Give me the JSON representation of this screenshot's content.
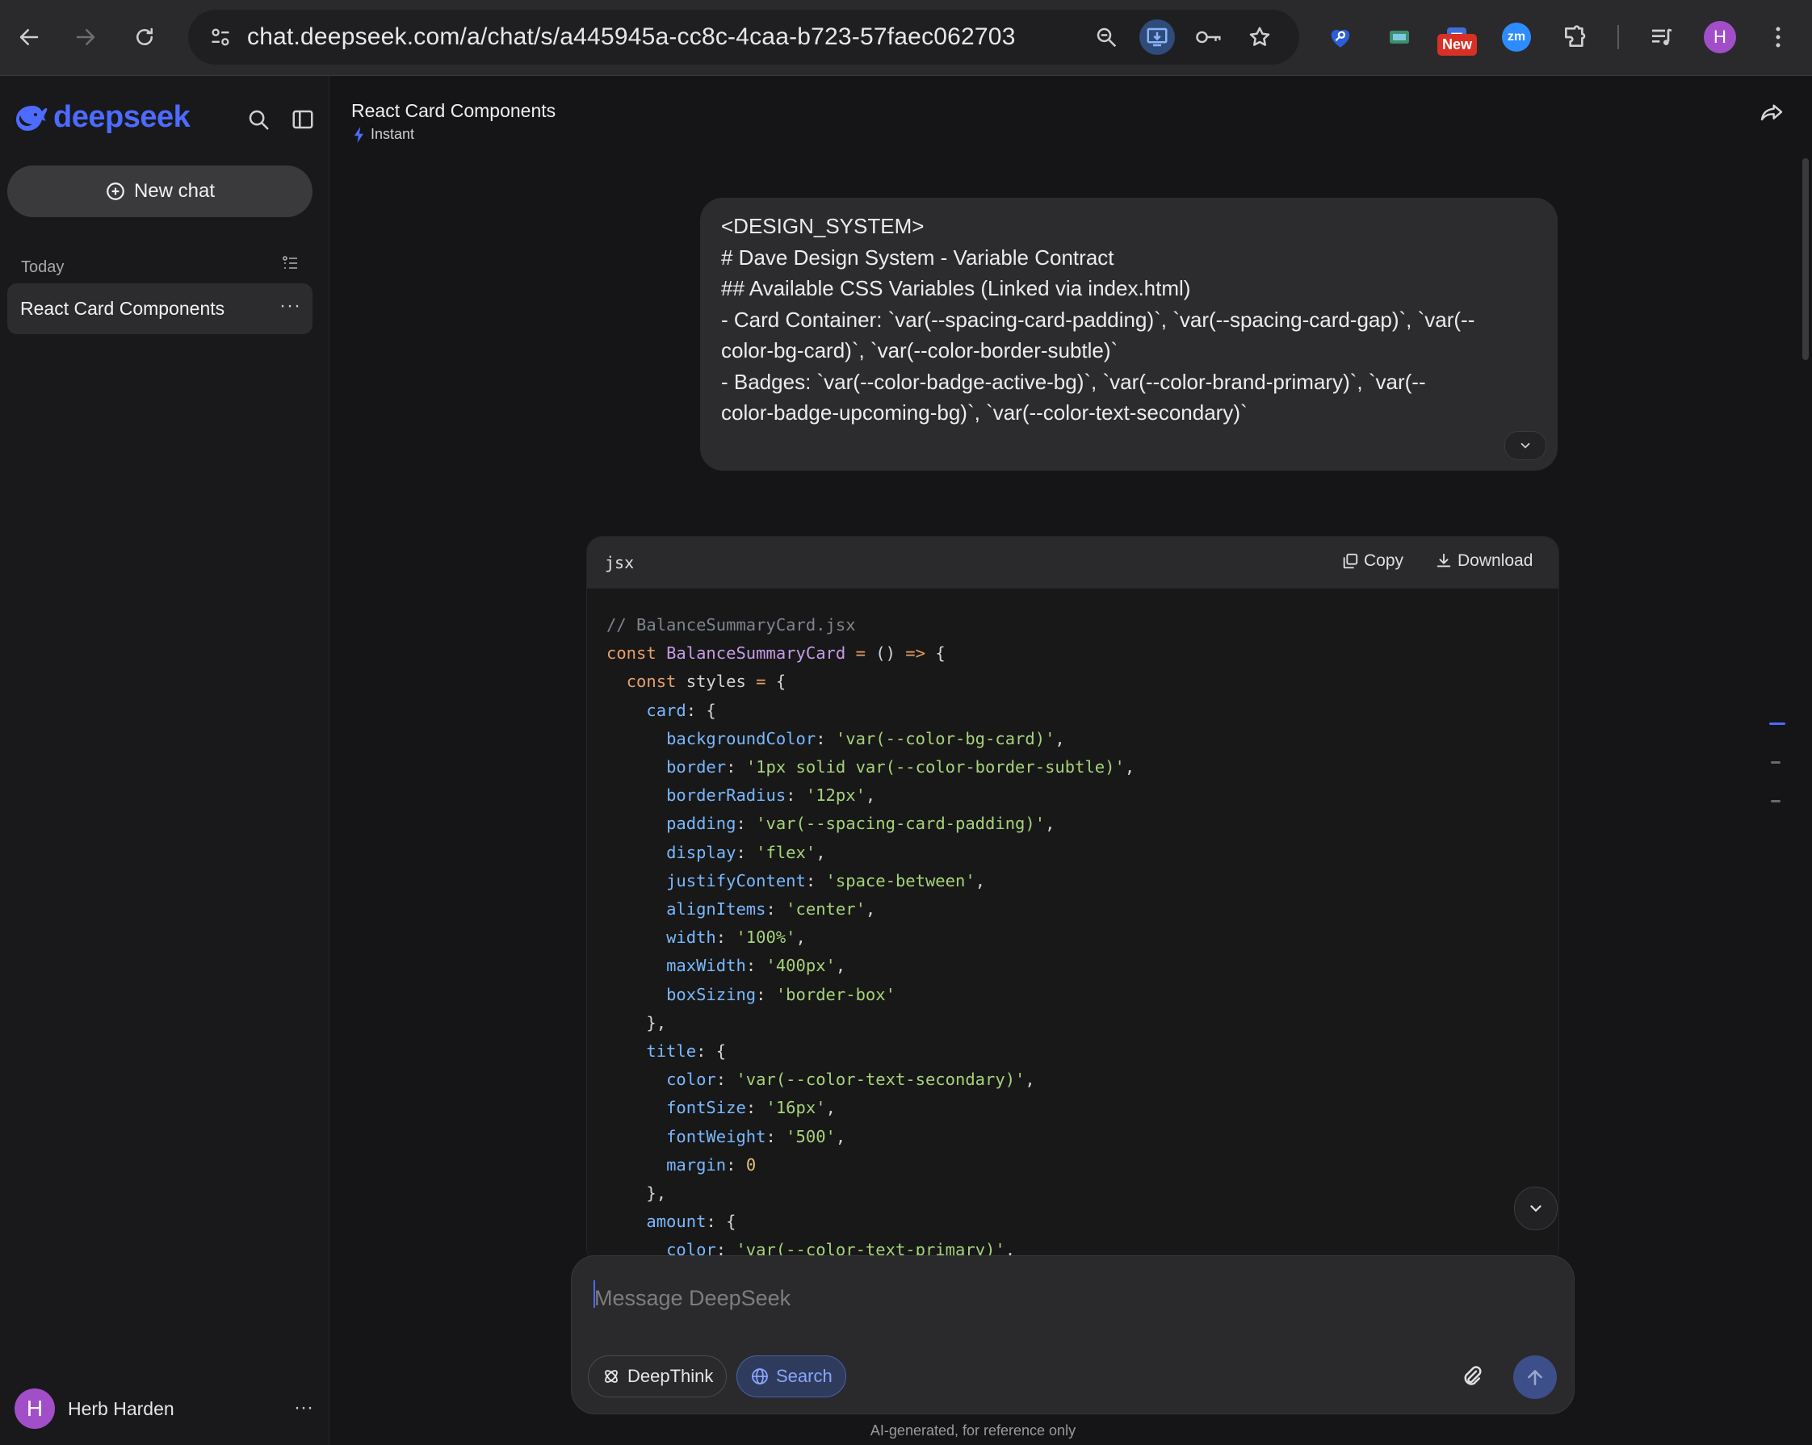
{
  "browser": {
    "url": "chat.deepseek.com/a/chat/s/a445945a-cc8c-4caa-b723-57faec062703",
    "new_badge": "New",
    "zoom_ext_label": "zm",
    "profile_initial": "H"
  },
  "sidebar": {
    "logo_text": "deepseek",
    "new_chat_label": "New chat",
    "section_today": "Today",
    "chats": [
      {
        "label": "React Card Components",
        "more": "···"
      }
    ],
    "user": {
      "initial": "H",
      "name": "Herb Harden",
      "more": "···"
    }
  },
  "chat": {
    "title": "React Card Components",
    "mode": "Instant",
    "user_message_lines": [
      "<DESIGN_SYSTEM>",
      "# Dave Design System - Variable Contract",
      "",
      "## Available CSS Variables (Linked via index.html)",
      "- Card Container: `var(--spacing-card-padding)`, `var(--spacing-card-gap)`, `var(--",
      "color-bg-card)`, `var(--color-border-subtle)`",
      "- Badges: `var(--color-badge-active-bg)`, `var(--color-brand-primary)`, `var(--",
      "color-badge-upcoming-bg)`, `var(--color-text-secondary)`"
    ],
    "code_block": {
      "language": "jsx",
      "copy_label": "Copy",
      "download_label": "Download",
      "lines": [
        [
          [
            "c",
            "// BalanceSummaryCard.jsx"
          ]
        ],
        [
          [
            "k",
            "const "
          ],
          [
            "f",
            "BalanceSummaryCard"
          ],
          [
            "o",
            " "
          ],
          [
            "k",
            "="
          ],
          [
            "o",
            " () "
          ],
          [
            "k",
            "=>"
          ],
          [
            "o",
            " {"
          ]
        ],
        [
          [
            "o",
            "  "
          ],
          [
            "k",
            "const "
          ],
          [
            "o",
            "styles "
          ],
          [
            "k",
            "="
          ],
          [
            "o",
            " {"
          ]
        ],
        [
          [
            "o",
            "    "
          ],
          [
            "p",
            "card"
          ],
          [
            "o",
            ": {"
          ]
        ],
        [
          [
            "o",
            "      "
          ],
          [
            "p",
            "backgroundColor"
          ],
          [
            "o",
            ": "
          ],
          [
            "s",
            "'var(--color-bg-card)'"
          ],
          [
            "o",
            ","
          ]
        ],
        [
          [
            "o",
            "      "
          ],
          [
            "p",
            "border"
          ],
          [
            "o",
            ": "
          ],
          [
            "s",
            "'1px solid var(--color-border-subtle)'"
          ],
          [
            "o",
            ","
          ]
        ],
        [
          [
            "o",
            "      "
          ],
          [
            "p",
            "borderRadius"
          ],
          [
            "o",
            ": "
          ],
          [
            "s",
            "'12px'"
          ],
          [
            "o",
            ","
          ]
        ],
        [
          [
            "o",
            "      "
          ],
          [
            "p",
            "padding"
          ],
          [
            "o",
            ": "
          ],
          [
            "s",
            "'var(--spacing-card-padding)'"
          ],
          [
            "o",
            ","
          ]
        ],
        [
          [
            "o",
            "      "
          ],
          [
            "p",
            "display"
          ],
          [
            "o",
            ": "
          ],
          [
            "s",
            "'flex'"
          ],
          [
            "o",
            ","
          ]
        ],
        [
          [
            "o",
            "      "
          ],
          [
            "p",
            "justifyContent"
          ],
          [
            "o",
            ": "
          ],
          [
            "s",
            "'space-between'"
          ],
          [
            "o",
            ","
          ]
        ],
        [
          [
            "o",
            "      "
          ],
          [
            "p",
            "alignItems"
          ],
          [
            "o",
            ": "
          ],
          [
            "s",
            "'center'"
          ],
          [
            "o",
            ","
          ]
        ],
        [
          [
            "o",
            "      "
          ],
          [
            "p",
            "width"
          ],
          [
            "o",
            ": "
          ],
          [
            "s",
            "'100%'"
          ],
          [
            "o",
            ","
          ]
        ],
        [
          [
            "o",
            "      "
          ],
          [
            "p",
            "maxWidth"
          ],
          [
            "o",
            ": "
          ],
          [
            "s",
            "'400px'"
          ],
          [
            "o",
            ","
          ]
        ],
        [
          [
            "o",
            "      "
          ],
          [
            "p",
            "boxSizing"
          ],
          [
            "o",
            ": "
          ],
          [
            "s",
            "'border-box'"
          ]
        ],
        [
          [
            "o",
            "    },"
          ]
        ],
        [
          [
            "o",
            "    "
          ],
          [
            "p",
            "title"
          ],
          [
            "o",
            ": {"
          ]
        ],
        [
          [
            "o",
            "      "
          ],
          [
            "p",
            "color"
          ],
          [
            "o",
            ": "
          ],
          [
            "s",
            "'var(--color-text-secondary)'"
          ],
          [
            "o",
            ","
          ]
        ],
        [
          [
            "o",
            "      "
          ],
          [
            "p",
            "fontSize"
          ],
          [
            "o",
            ": "
          ],
          [
            "s",
            "'16px'"
          ],
          [
            "o",
            ","
          ]
        ],
        [
          [
            "o",
            "      "
          ],
          [
            "p",
            "fontWeight"
          ],
          [
            "o",
            ": "
          ],
          [
            "s",
            "'500'"
          ],
          [
            "o",
            ","
          ]
        ],
        [
          [
            "o",
            "      "
          ],
          [
            "p",
            "margin"
          ],
          [
            "o",
            ": "
          ],
          [
            "n",
            "0"
          ]
        ],
        [
          [
            "o",
            "    },"
          ]
        ],
        [
          [
            "o",
            "    "
          ],
          [
            "p",
            "amount"
          ],
          [
            "o",
            ": {"
          ]
        ],
        [
          [
            "o",
            "      "
          ],
          [
            "p",
            "color"
          ],
          [
            "o",
            ": "
          ],
          [
            "s",
            "'var(--color-text-primary)'"
          ],
          [
            "o",
            ","
          ]
        ]
      ]
    }
  },
  "composer": {
    "placeholder": "Message DeepSeek",
    "deepthink_label": "DeepThink",
    "search_label": "Search"
  },
  "footer_note": "AI-generated, for reference only",
  "colors": {
    "brand": "#4d6bfe",
    "background": "#151517",
    "sidebar": "#19191b",
    "bubble": "#2c2c2f"
  }
}
